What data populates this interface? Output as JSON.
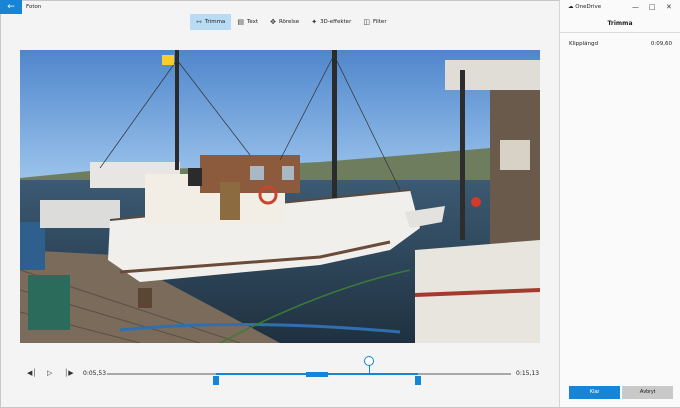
{
  "app": {
    "title": "Foton",
    "back_icon": "arrow-left-icon"
  },
  "toolbar": {
    "items": [
      {
        "label": "Trimma",
        "icon": "trim-icon",
        "active": true
      },
      {
        "label": "Text",
        "icon": "text-icon"
      },
      {
        "label": "Rörelse",
        "icon": "motion-icon"
      },
      {
        "label": "3D-effekter",
        "icon": "3d-effects-icon"
      },
      {
        "label": "Filter",
        "icon": "filter-icon"
      }
    ]
  },
  "playback": {
    "start_time": "0:05,53",
    "end_time": "0:15,13",
    "trim_handles": "trim-handle-icon"
  },
  "panel": {
    "window_title": "OneDrive",
    "heading": "Trimma",
    "clip_length_label": "Klipplängd",
    "clip_length_value": "0:09,60",
    "done_label": "Klar",
    "cancel_label": "Avbryt"
  },
  "colors": {
    "accent": "#1685d8",
    "panel_bg": "#fafafa",
    "app_bg": "#f4f4f4"
  }
}
